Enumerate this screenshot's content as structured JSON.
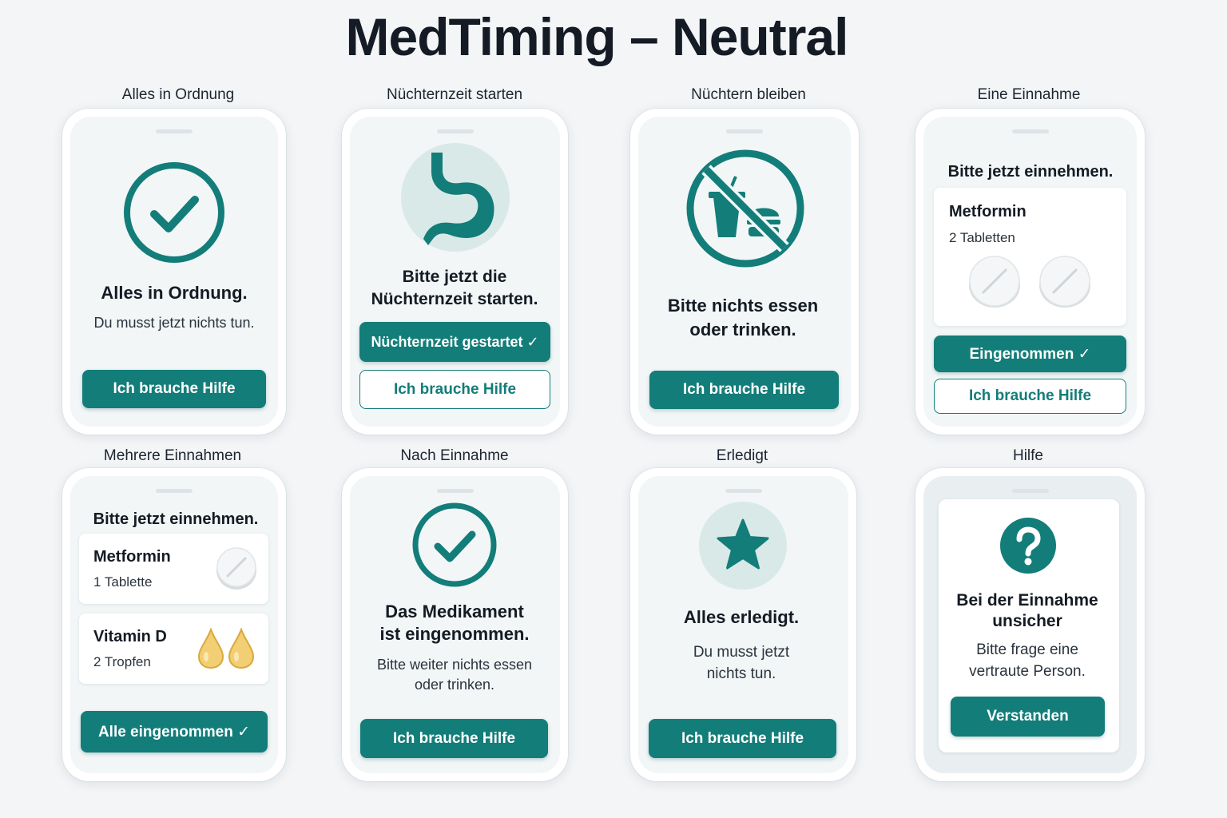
{
  "app_title": "MedTiming – Neutral",
  "colors": {
    "accent": "#137d79",
    "background": "#f3f5f7",
    "drop": "#e8b84a"
  },
  "screens": [
    {
      "label": "Alles in Ordnung",
      "icon": "check-circle-icon",
      "heading": "Alles in Ordnung.",
      "text": "Du musst jetzt nichts tun.",
      "primary_button": "Ich brauche Hilfe"
    },
    {
      "label": "Nüchternzeit starten",
      "icon": "stomach-icon",
      "heading_line1": "Bitte jetzt die",
      "heading_line2": "Nüchternzeit starten.",
      "primary_button": "Nüchternzeit gestartet ✓",
      "secondary_button": "Ich brauche Hilfe"
    },
    {
      "label": "Nüchtern bleiben",
      "icon": "no-food-drink-icon",
      "heading_line1": "Bitte nichts essen",
      "heading_line2": "oder trinken.",
      "primary_button": "Ich brauche Hilfe"
    },
    {
      "label": "Eine Einnahme",
      "heading": "Bitte jetzt einnehmen.",
      "medication": {
        "name": "Metformin",
        "dose": "2 Tabletten",
        "icon": "tablet-icon"
      },
      "primary_button": "Eingenommen ✓",
      "secondary_button": "Ich brauche Hilfe"
    },
    {
      "label": "Mehrere Einnahmen",
      "heading": "Bitte jetzt einnehmen.",
      "medications": [
        {
          "name": "Metformin",
          "dose": "1 Tablette",
          "icon": "tablet-icon"
        },
        {
          "name": "Vitamin D",
          "dose": "2 Tropfen",
          "icon": "drop-icon"
        }
      ],
      "primary_button": "Alle eingenommen ✓"
    },
    {
      "label": "Nach Einnahme",
      "icon": "check-circle-icon",
      "heading_line1": "Das Medikament",
      "heading_line2": "ist eingenommen.",
      "text_line1": "Bitte weiter nichts essen",
      "text_line2": "oder trinken.",
      "primary_button": "Ich brauche Hilfe"
    },
    {
      "label": "Erledigt",
      "icon": "star-icon",
      "heading": "Alles erledigt.",
      "text_line1": "Du musst jetzt",
      "text_line2": "nichts tun.",
      "primary_button": "Ich brauche Hilfe"
    },
    {
      "label": "Hilfe",
      "icon": "question-icon",
      "heading_line1": "Bei der Einnahme",
      "heading_line2": "unsicher",
      "text_line1": "Bitte frage eine",
      "text_line2": "vertraute Person.",
      "primary_button": "Verstanden"
    }
  ]
}
